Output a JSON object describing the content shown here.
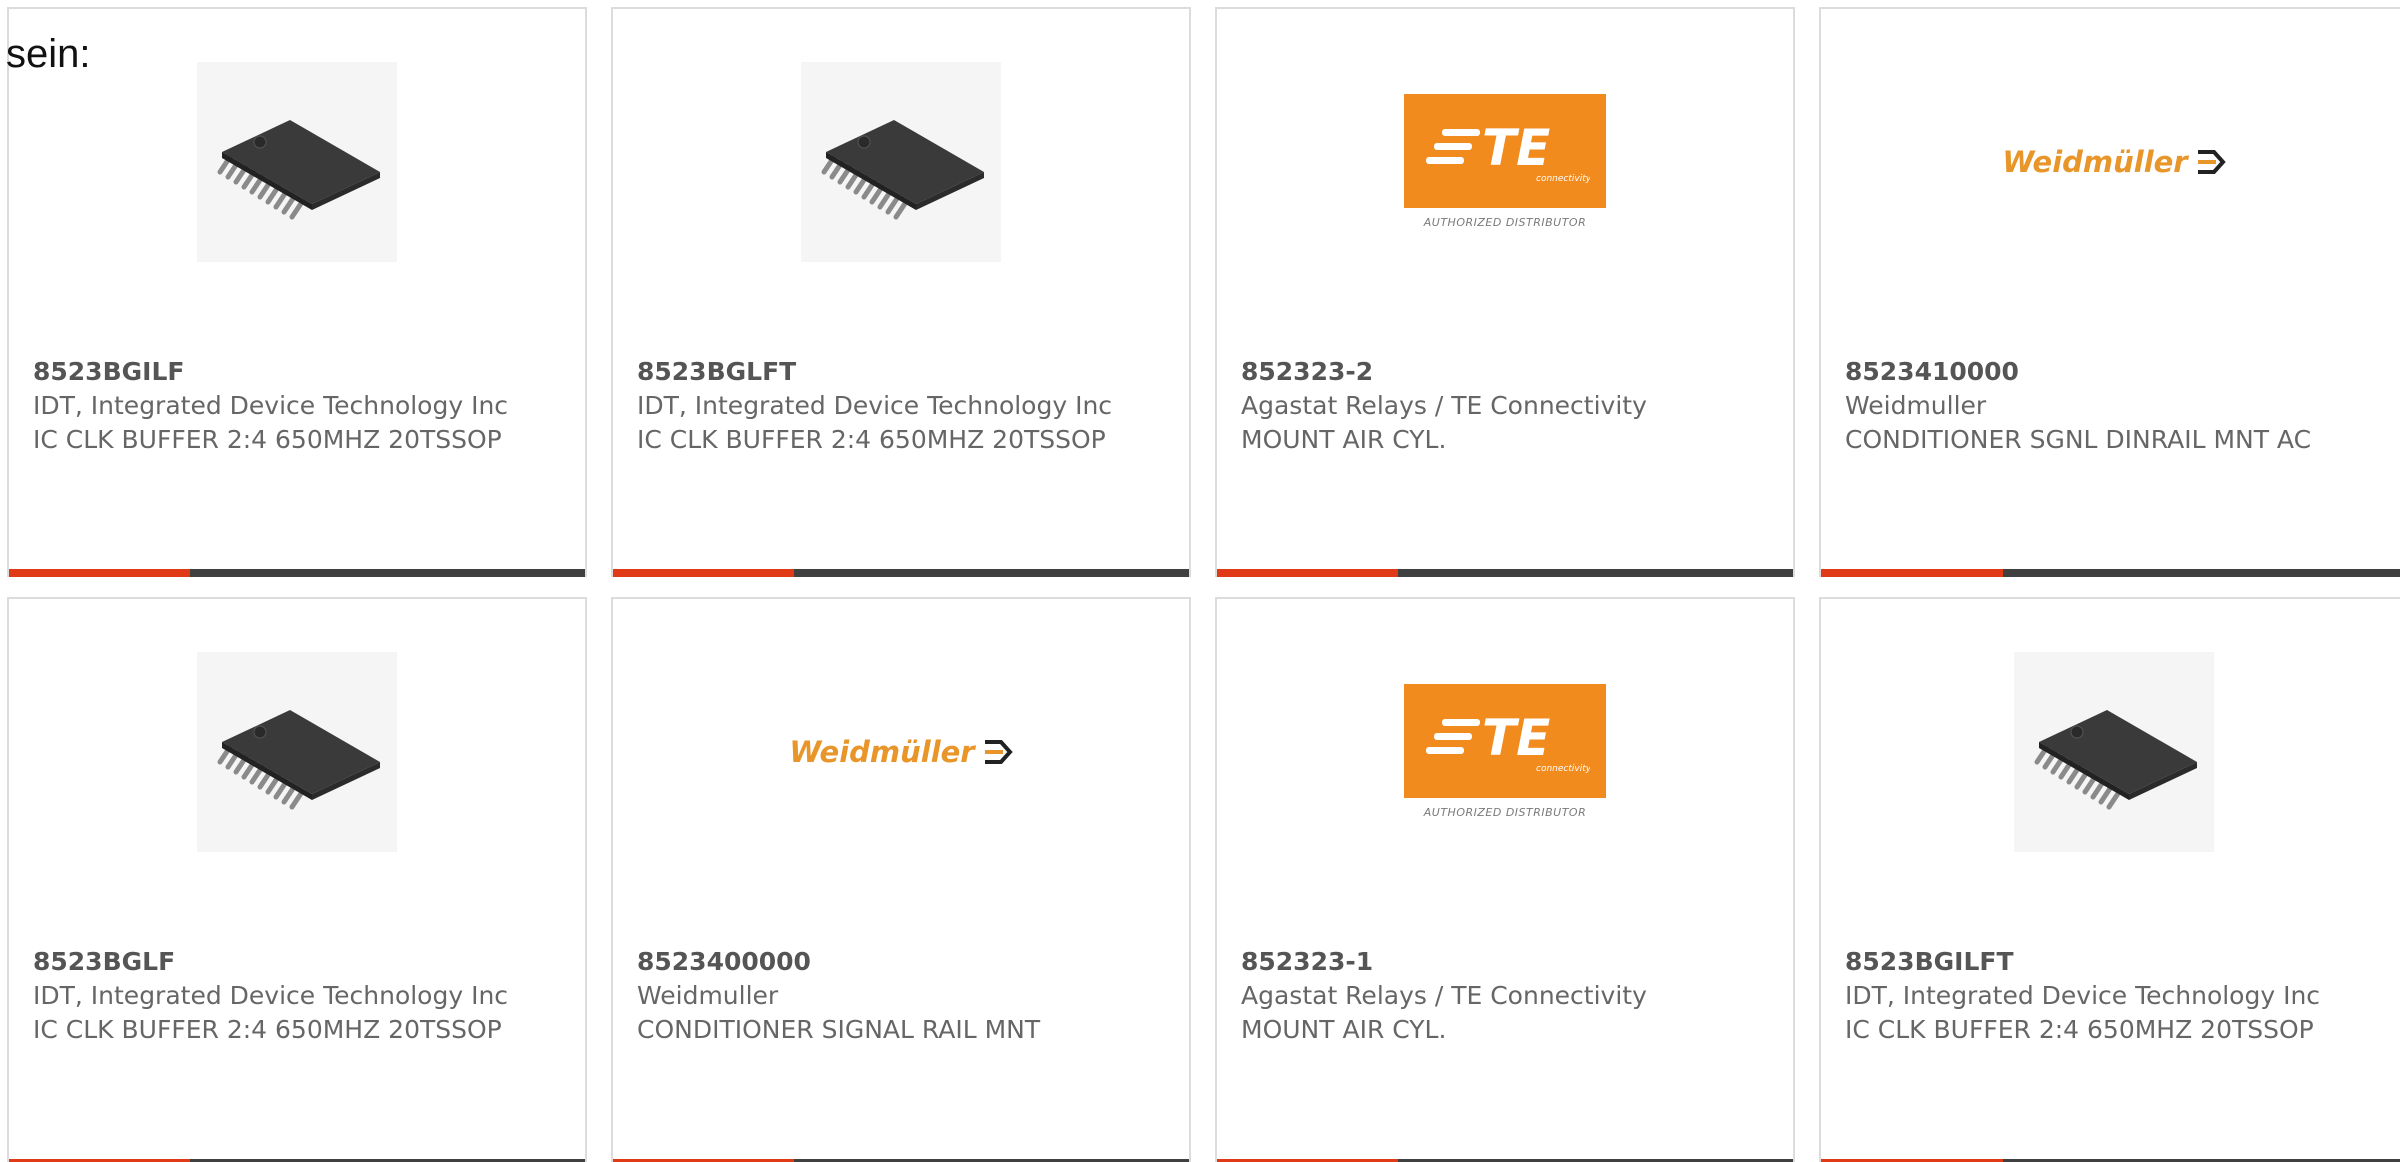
{
  "intro_text": "sein:",
  "accent_color": "#e03a16",
  "bar_color": "#404040",
  "products": [
    {
      "image": "ic-chip-icon",
      "part_number": "8523BGILF",
      "manufacturer": "IDT, Integrated Device Technology Inc",
      "description": "IC CLK BUFFER 2:4 650MHZ 20TSSOP"
    },
    {
      "image": "ic-chip-icon",
      "part_number": "8523BGLFT",
      "manufacturer": "IDT, Integrated Device Technology Inc",
      "description": "IC CLK BUFFER 2:4 650MHZ 20TSSOP"
    },
    {
      "image": "te-connectivity-logo",
      "logo_text": "TE",
      "logo_subtext": "connectivity",
      "logo_caption": "AUTHORIZED DISTRIBUTOR",
      "part_number": "852323-2",
      "manufacturer": "Agastat Relays / TE Connectivity",
      "description": "MOUNT AIR CYL."
    },
    {
      "image": "weidmuller-logo",
      "logo_text": "Weidmüller",
      "part_number": "8523410000",
      "manufacturer": "Weidmuller",
      "description": "CONDITIONER SGNL DINRAIL MNT AC"
    },
    {
      "image": "ic-chip-icon",
      "part_number": "8523BGLF",
      "manufacturer": "IDT, Integrated Device Technology Inc",
      "description": "IC CLK BUFFER 2:4 650MHZ 20TSSOP"
    },
    {
      "image": "weidmuller-logo",
      "logo_text": "Weidmüller",
      "part_number": "8523400000",
      "manufacturer": "Weidmuller",
      "description": "CONDITIONER SIGNAL RAIL MNT"
    },
    {
      "image": "te-connectivity-logo",
      "logo_text": "TE",
      "logo_subtext": "connectivity",
      "logo_caption": "AUTHORIZED DISTRIBUTOR",
      "part_number": "852323-1",
      "manufacturer": "Agastat Relays / TE Connectivity",
      "description": "MOUNT AIR CYL."
    },
    {
      "image": "ic-chip-icon",
      "part_number": "8523BGILFT",
      "manufacturer": "IDT, Integrated Device Technology Inc",
      "description": "IC CLK BUFFER 2:4 650MHZ 20TSSOP"
    }
  ]
}
